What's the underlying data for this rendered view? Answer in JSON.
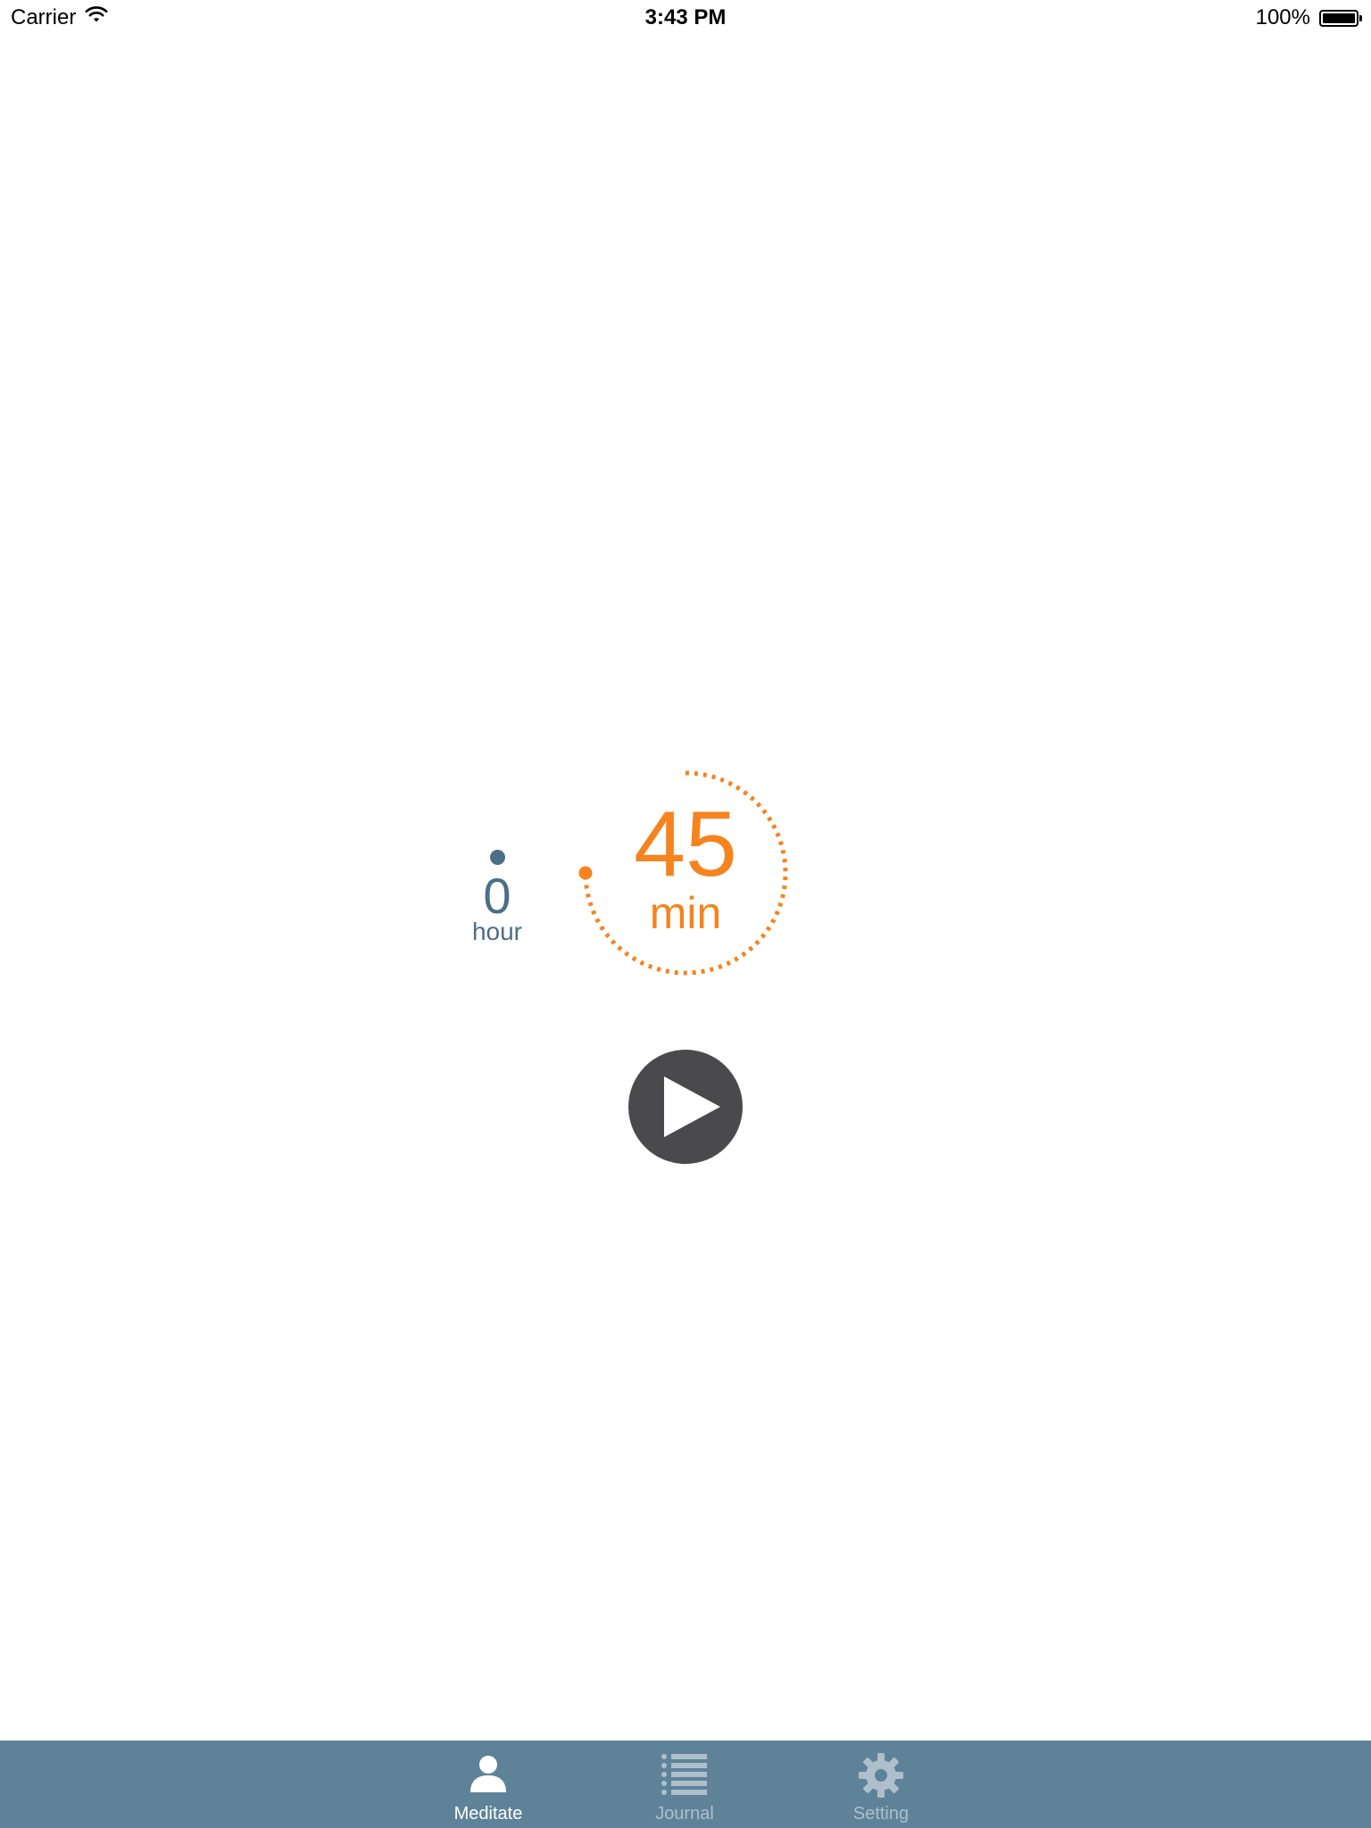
{
  "status_bar": {
    "carrier": "Carrier",
    "time": "3:43 PM",
    "battery": "100%",
    "battery_level": 1.0,
    "icons": [
      "wifi-icon",
      "battery-icon"
    ]
  },
  "timer": {
    "hour_value": "0",
    "hour_unit": "hour",
    "minute_value": "45",
    "minute_unit": "min",
    "minute_fraction": 0.75,
    "colors": {
      "hour": "#4a6f87",
      "minute": "#f5841f"
    }
  },
  "play_button": {
    "icon": "play-icon",
    "color": "#4a4a4c"
  },
  "tab_bar": {
    "background": "#5e8399",
    "tabs": [
      {
        "label": "Meditate",
        "icon": "person-icon",
        "active": true
      },
      {
        "label": "Journal",
        "icon": "list-icon",
        "active": false
      },
      {
        "label": "Setting",
        "icon": "gear-icon",
        "active": false
      }
    ]
  }
}
